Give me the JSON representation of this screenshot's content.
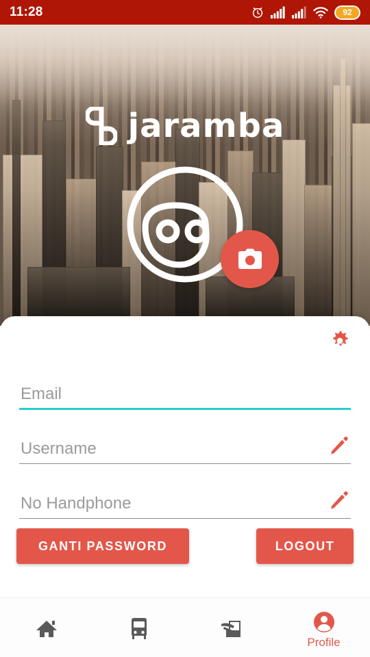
{
  "status_bar": {
    "time": "11:28",
    "battery_level": "92",
    "background_color": "#AF1605",
    "battery_pill_color": "#F5A623",
    "icons": [
      "alarm-clock-icon",
      "signal-bars-sim1-icon",
      "signal-bars-sim2-icon",
      "wifi-icon",
      "battery-pill"
    ]
  },
  "brand": {
    "wordmark": "jaramba",
    "mark_icon": "jaramba-monogram-icon",
    "wordmark_color": "#FFFFFF"
  },
  "hero": {
    "background_description": "aerial photo of New York City skyline at dusk",
    "avatar_icon": "avatar-face-placeholder-icon",
    "camera_button_icon": "camera-icon",
    "camera_button_color": "#E3574A"
  },
  "card": {
    "settings_icon": "gear-icon",
    "settings_icon_color": "#E3574A",
    "accent_color": "#E3574A",
    "focus_color": "#27CDCD",
    "fields": [
      {
        "name": "email",
        "placeholder": "Email",
        "value": "",
        "focused": true,
        "has_edit_icon": false,
        "underline_color": "#27CDCD"
      },
      {
        "name": "username",
        "placeholder": "Username",
        "value": "",
        "focused": false,
        "has_edit_icon": true,
        "edit_icon": "pencil-icon",
        "underline_color": "#8C8C8C"
      },
      {
        "name": "phone",
        "placeholder": "No Handphone",
        "value": "",
        "focused": false,
        "has_edit_icon": true,
        "edit_icon": "pencil-icon",
        "underline_color": "#8C8C8C"
      }
    ],
    "buttons": {
      "change_password": "GANTI PASSWORD",
      "logout": "LOGOUT"
    }
  },
  "bottom_nav": {
    "items": [
      {
        "name": "home",
        "icon": "home-icon",
        "label": "",
        "active": false
      },
      {
        "name": "bus",
        "icon": "bus-icon",
        "label": "",
        "active": false
      },
      {
        "name": "booking",
        "icon": "ticket-order-icon",
        "label": "",
        "active": false
      },
      {
        "name": "profile",
        "icon": "person-circle-icon",
        "label": "Profile",
        "active": true
      }
    ],
    "active_color": "#E3574A",
    "inactive_color": "#5A5A5A"
  }
}
